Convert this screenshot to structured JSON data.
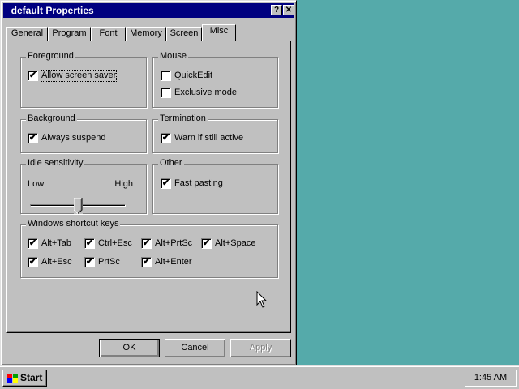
{
  "window": {
    "title": "_default Properties"
  },
  "titlebar_buttons": {
    "help": "?",
    "close": "✕"
  },
  "tabs": [
    {
      "label": "General"
    },
    {
      "label": "Program"
    },
    {
      "label": "Font"
    },
    {
      "label": "Memory"
    },
    {
      "label": "Screen"
    },
    {
      "label": "Misc"
    }
  ],
  "active_tab": "Misc",
  "groups": {
    "foreground": {
      "title": "Foreground",
      "allow_screen_saver": {
        "label": "Allow screen saver",
        "checked": true
      }
    },
    "mouse": {
      "title": "Mouse",
      "quickedit": {
        "label": "QuickEdit",
        "checked": false
      },
      "exclusive_mode": {
        "label": "Exclusive mode",
        "checked": false
      }
    },
    "background": {
      "title": "Background",
      "always_suspend": {
        "label": "Always suspend",
        "checked": true
      }
    },
    "termination": {
      "title": "Termination",
      "warn_if_active": {
        "label": "Warn if still active",
        "checked": true
      }
    },
    "idle": {
      "title": "Idle sensitivity",
      "low_label": "Low",
      "high_label": "High",
      "level": 0.5
    },
    "other": {
      "title": "Other",
      "fast_pasting": {
        "label": "Fast pasting",
        "checked": true
      }
    },
    "shortcut_keys": {
      "title": "Windows shortcut keys",
      "keys": [
        {
          "label": "Alt+Tab",
          "checked": true
        },
        {
          "label": "Ctrl+Esc",
          "checked": true
        },
        {
          "label": "Alt+PrtSc",
          "checked": true
        },
        {
          "label": "Alt+Space",
          "checked": true
        },
        {
          "label": "Alt+Esc",
          "checked": true
        },
        {
          "label": "PrtSc",
          "checked": true
        },
        {
          "label": "Alt+Enter",
          "checked": true
        }
      ]
    }
  },
  "buttons": {
    "ok": "OK",
    "cancel": "Cancel",
    "apply": "Apply"
  },
  "taskbar": {
    "start_label": "Start",
    "clock": "1:45 AM"
  },
  "check_glyph": "✔",
  "colors": {
    "desktop": "#55aaaa",
    "titlebar": "#000080",
    "face": "#c0c0c0"
  }
}
